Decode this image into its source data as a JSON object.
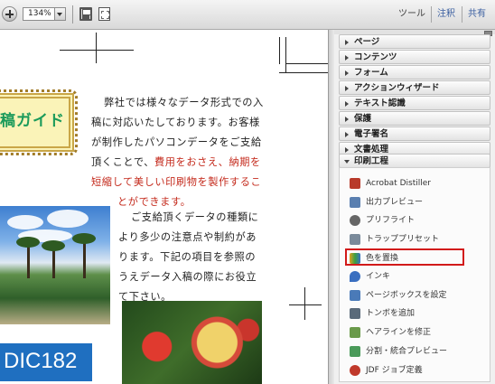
{
  "toolbar": {
    "zoom": "134%",
    "tools": "ツール",
    "comment": "注釈",
    "share": "共有"
  },
  "document": {
    "title": "稿ガイド",
    "para1": [
      "弊社では様々なデータ形式での入",
      "稿に対応いたしております。お客様",
      "が制作したパソコンデータをご支給",
      "頂くことで、",
      "費用をおさえ、納期を",
      "短縮して美しい印刷物を製作するこ",
      "とができます。"
    ],
    "para2": [
      "ご支給頂くデータの種類に",
      "より多少の注意点や制約があ",
      "ります。下記の項目を参照の",
      "うえデータ入稿の際にお役立",
      "て下さい。"
    ],
    "banner": "DIC182"
  },
  "panel": {
    "sections": [
      {
        "label": "ページ",
        "open": false
      },
      {
        "label": "コンテンツ",
        "open": false
      },
      {
        "label": "フォーム",
        "open": false
      },
      {
        "label": "アクションウィザード",
        "open": false
      },
      {
        "label": "テキスト認識",
        "open": false
      },
      {
        "label": "保護",
        "open": false
      },
      {
        "label": "電子署名",
        "open": false
      },
      {
        "label": "文書処理",
        "open": false
      },
      {
        "label": "印刷工程",
        "open": true
      }
    ],
    "tools": [
      {
        "label": "Acrobat Distiller",
        "icon": "distiller-icon",
        "color": "#b83a2a"
      },
      {
        "label": "出力プレビュー",
        "icon": "output-preview-icon",
        "color": "#5a7fb0"
      },
      {
        "label": "プリフライト",
        "icon": "preflight-icon",
        "color": "#666666"
      },
      {
        "label": "トラッププリセット",
        "icon": "trap-preset-icon",
        "color": "#7a8a9a"
      },
      {
        "label": "色を置換",
        "icon": "color-replace-icon",
        "color": "#e0a020",
        "selected": true
      },
      {
        "label": "インキ",
        "icon": "ink-icon",
        "color": "#3a6fc0"
      },
      {
        "label": "ページボックスを設定",
        "icon": "page-box-icon",
        "color": "#4a7ab8"
      },
      {
        "label": "トンボを追加",
        "icon": "crop-marks-icon",
        "color": "#5a6a7a"
      },
      {
        "label": "ヘアラインを修正",
        "icon": "hairline-icon",
        "color": "#6a9a4a"
      },
      {
        "label": "分割・統合プレビュー",
        "icon": "flatten-preview-icon",
        "color": "#4a9a5a"
      },
      {
        "label": "JDF ジョブ定義",
        "icon": "jdf-icon",
        "color": "#c0392b"
      }
    ]
  }
}
